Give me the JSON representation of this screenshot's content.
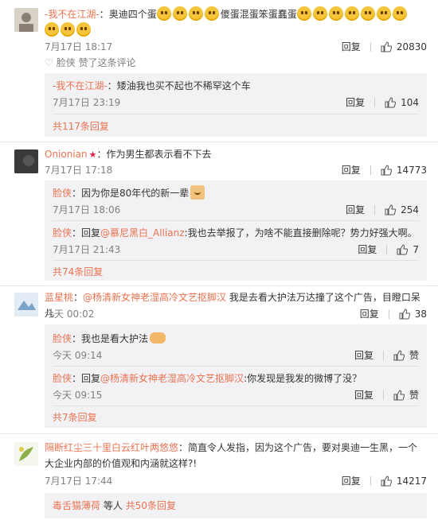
{
  "comments": [
    {
      "user": "-我不在江湖-",
      "text": "奥迪四个蛋",
      "text2": "傻蛋混蛋笨蛋蠢蛋",
      "date": "7月17日 18:17",
      "reply": "回复",
      "likes": "20830",
      "liked_by": "脸侠 赞了这条评论",
      "replies": [
        {
          "user": "-我不在江湖-",
          "text": "矮油我也买不起也不稀罕这个车",
          "date": "7月17日 23:19",
          "reply": "回复",
          "likes": "104"
        }
      ],
      "more": "共117条回复"
    },
    {
      "user": "Onionian",
      "text": "作为男生都表示看不下去",
      "date": "7月17日 17:18",
      "reply": "回复",
      "likes": "14773",
      "replies": [
        {
          "user": "脸侠",
          "text": "因为你是80年代的新一辈",
          "date": "7月17日 18:06",
          "reply": "回复",
          "likes": "254"
        },
        {
          "user": "脸侠",
          "prefix": "回复",
          "mention": "@慕尼黑白_Allianz",
          "text": ":我也去举报了，为啥不能直接删除呢？势力好强大啊。",
          "date": "7月17日 21:43",
          "reply": "回复",
          "likes": "7"
        }
      ],
      "more": "共74条回复"
    },
    {
      "user": "蓝星桃",
      "mention": "@杨清新女神老湿高冷文艺抠脚汉",
      "text": "我是去看大护法万达撞了这个广告，目瞪口呆儿",
      "date": "今天 00:02",
      "reply": "回复",
      "likes": "38",
      "replies": [
        {
          "user": "脸侠",
          "text": "我也是看大护法",
          "date": "今天 09:14",
          "reply": "回复",
          "likes": "赞"
        },
        {
          "user": "脸侠",
          "prefix": "回复",
          "mention": "@杨清新女神老湿高冷文艺抠脚汉",
          "text": ":你发现是我发的微博了没？",
          "date": "今天 09:15",
          "reply": "回复",
          "likes": "赞"
        }
      ],
      "more": "共7条回复"
    },
    {
      "user": "隔断红尘三十里白云红叶两悠悠",
      "text": "简直令人发指，因为这个广告，要对奥迪一生黑，一个大企业内部的价值观和内涵就这样?!",
      "date": "7月17日 17:44",
      "reply": "回复",
      "likes": "14217",
      "replies": [],
      "more_user": "毒舌猫薄荷",
      "more_mid": "等人",
      "more": "共50条回复"
    }
  ],
  "colors": {
    "accent": "#eb7350",
    "text": "#333333",
    "meta": "#808080",
    "sub_bg": "#f2f2f5"
  }
}
